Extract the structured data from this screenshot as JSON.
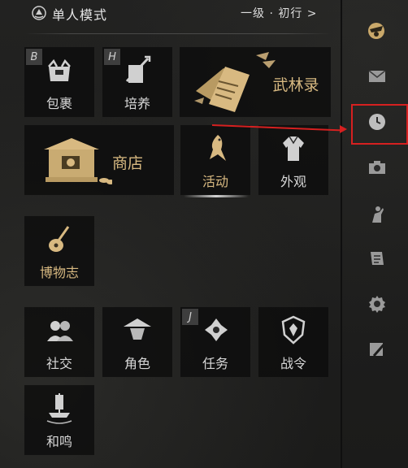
{
  "header": {
    "mode_label": "单人模式",
    "level_link": "一级 · 初行 >"
  },
  "tiles": {
    "bag": {
      "label": "包裹",
      "hotkey": "B"
    },
    "cultivate": {
      "label": "培养",
      "hotkey": "H"
    },
    "martial_record": {
      "label": "武林录"
    },
    "shop": {
      "label": "商店"
    },
    "activity": {
      "label": "活动"
    },
    "appearance": {
      "label": "外观"
    },
    "museum": {
      "label": "博物志"
    },
    "social": {
      "label": "社交"
    },
    "character": {
      "label": "角色"
    },
    "quest": {
      "label": "任务",
      "hotkey": "J"
    },
    "battle_pass": {
      "label": "战令"
    },
    "harmony": {
      "label": "和鸣"
    }
  },
  "sidebar": {
    "icons": [
      "avatar-icon",
      "mail-icon",
      "clock-icon",
      "camera-icon",
      "figure-icon",
      "scroll-icon",
      "gear-icon",
      "edit-icon"
    ]
  },
  "colors": {
    "gold": "#d8b981",
    "annotation": "#d62020",
    "tile_bg": "#0c0c0c"
  }
}
